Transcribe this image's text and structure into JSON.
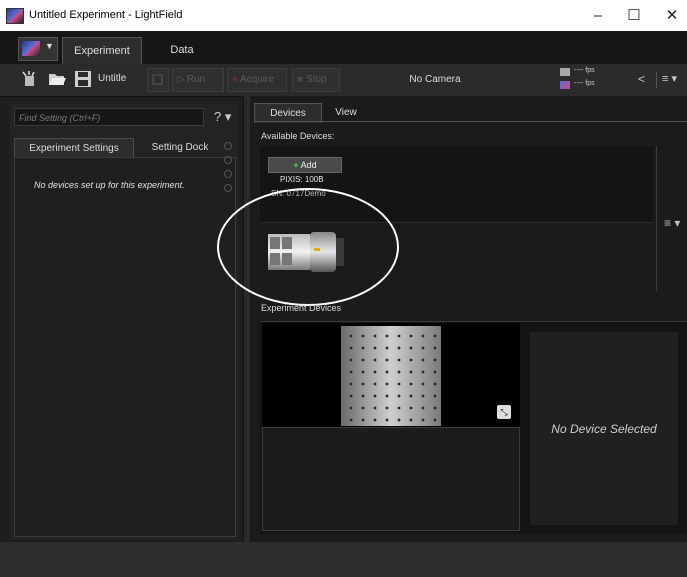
{
  "window": {
    "title": "Untitled Experiment - LightField",
    "minimize": "–",
    "maximize": "☐",
    "close": "✕"
  },
  "tabs": {
    "experiment": "Experiment",
    "data": "Data"
  },
  "toolbar": {
    "filename": "Untitle",
    "run": "Run",
    "acquire": "Acquire",
    "stop": "Stop",
    "camera_status": "No Camera",
    "fps_top": "---- fps",
    "fps_bottom": "---- fps",
    "collapse": "<",
    "menu": "≡ ▾"
  },
  "left": {
    "search_placeholder": "Find Setting (Ctrl+F)",
    "help": "? ▾",
    "tab_settings": "Experiment Settings",
    "tab_dock": "Setting Dock",
    "empty_message": "No devices set up for this experiment."
  },
  "right": {
    "tab_devices": "Devices",
    "tab_view": "View",
    "available_label": "Available Devices:",
    "add_label": "Add",
    "device_name": "PIXIS: 100B",
    "device_sn": "SN: 0717Demo",
    "menu": "≡ ▾",
    "experiment_devices_label": "Experiment Devices",
    "no_device_selected": "No Device Selected"
  }
}
